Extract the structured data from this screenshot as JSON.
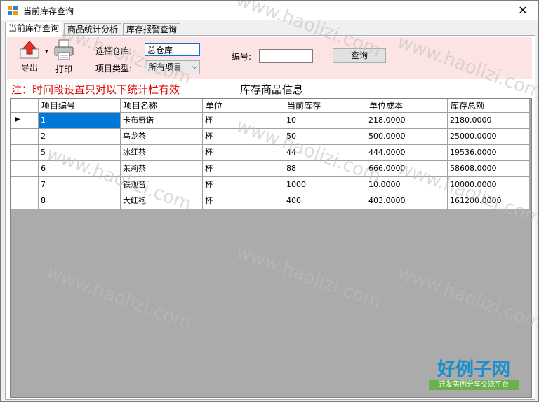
{
  "window": {
    "title": "当前库存查询",
    "close_glyph": "✕"
  },
  "tabs": [
    {
      "label": "当前库存查询",
      "active": true
    },
    {
      "label": "商品统计分析",
      "active": false
    },
    {
      "label": "库存报警查询",
      "active": false
    }
  ],
  "toolbar": {
    "export_label": "导出",
    "print_label": "打印",
    "warehouse_label": "选择仓库:",
    "warehouse_value": "总仓库",
    "type_label": "项目类型:",
    "type_value": "所有项目",
    "code_label": "编号:",
    "code_value": "",
    "query_label": "查询"
  },
  "note": "注：时间段设置只对以下统计栏有效",
  "grid": {
    "title": "库存商品信息",
    "columns": [
      "项目编号",
      "项目名称",
      "单位",
      "当前库存",
      "单位成本",
      "库存总额"
    ],
    "rows": [
      [
        "1",
        "卡布奇诺",
        "杯",
        "10",
        "218.0000",
        "2180.0000"
      ],
      [
        "2",
        "乌龙茶",
        "杯",
        "50",
        "500.0000",
        "25000.0000"
      ],
      [
        "5",
        "冰红茶",
        "杯",
        "44",
        "444.0000",
        "19536.0000"
      ],
      [
        "6",
        "茉莉茶",
        "杯",
        "88",
        "666.0000",
        "58608.0000"
      ],
      [
        "7",
        "铁观音",
        "杯",
        "1000",
        "10.0000",
        "10000.0000"
      ],
      [
        "8",
        "大红袍",
        "杯",
        "400",
        "403.0000",
        "161200.0000"
      ]
    ],
    "current_row_marker": "▶"
  },
  "watermark": "www.haolizi.com",
  "brand": {
    "main": "好例子网",
    "sub": "开发实例分享交流平台"
  },
  "colors": {
    "selection": "#0078d7",
    "note": "#e00000",
    "toolbar_bg": "#fde4e4",
    "grid_bg": "#ababab"
  }
}
